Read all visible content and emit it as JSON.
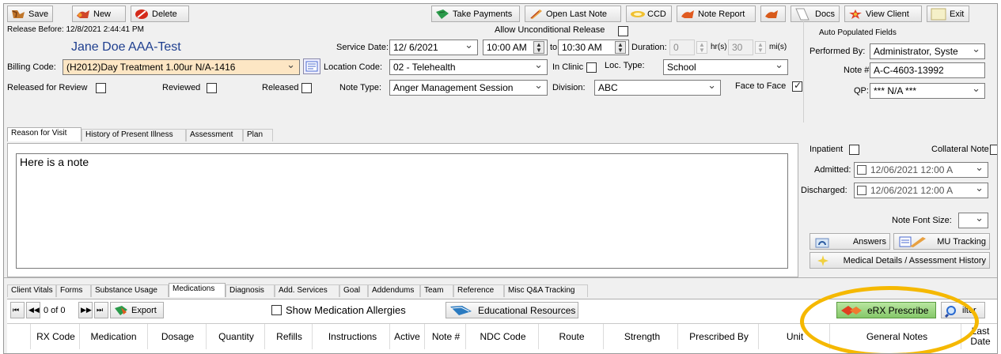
{
  "toolbar": {
    "save": "Save",
    "new": "New",
    "delete": "Delete",
    "take_payments": "Take Payments",
    "open_last_note": "Open Last Note",
    "ccd": "CCD",
    "note_report": "Note Report",
    "docs": "Docs",
    "view_client": "View Client",
    "exit": "Exit"
  },
  "header": {
    "release_before": "Release Before: 12/8/2021 2:44:41 PM",
    "client_name": "Jane Doe AAA-Test",
    "allow_unconditional_release": "Allow Unconditional Release",
    "auto_populated_fields": "Auto Populated Fields"
  },
  "form": {
    "billing_code_label": "Billing Code:",
    "billing_code_value": "(H2012)Day Treatment   1.00ur  N/A-1416",
    "service_date_label": "Service Date:",
    "service_date_value": "12/ 6/2021",
    "time_from": "10:00 AM",
    "to_label": "to",
    "time_to": "10:30 AM",
    "duration_label": "Duration:",
    "duration_hours": "0",
    "hrs_label": "hr(s)",
    "duration_minutes": "30",
    "mins_label": "mi(s)",
    "location_code_label": "Location Code:",
    "location_code_value": "02 - Telehealth",
    "in_clinic_label": "In Clinic",
    "loc_type_label": "Loc. Type:",
    "loc_type_value": "School",
    "released_for_review": "Released for Review",
    "reviewed": "Reviewed",
    "released": "Released",
    "note_type_label": "Note Type:",
    "note_type_value": "Anger Management Session",
    "division_label": "Division:",
    "division_value": "ABC",
    "face_to_face": "Face to Face",
    "performed_by_label": "Performed By:",
    "performed_by_value": "Administrator, Syste",
    "note_num_label": "Note #:",
    "note_num_value": "A-C-4603-13992",
    "qp_label": "QP:",
    "qp_value": "*** N/A ***"
  },
  "note_tabs": [
    "Reason for Visit",
    "History of Present Illness",
    "Assessment",
    "Plan"
  ],
  "note_text": "Here is a note",
  "right_panel": {
    "inpatient": "Inpatient",
    "collateral_note": "Collateral Note",
    "admitted_label": "Admitted:",
    "admitted_value": "12/06/2021 12:00 A",
    "discharged_label": "Discharged:",
    "discharged_value": "12/06/2021 12:00 A",
    "note_font_size": "Note Font Size:",
    "answers": "Answers",
    "mu_tracking": "MU Tracking",
    "medical_details": "Medical Details / Assessment History"
  },
  "bottom_tabs": [
    "Client Vitals",
    "Forms",
    "Substance Usage",
    "Medications",
    "Diagnosis",
    "Add. Services",
    "Goal",
    "Addendums",
    "Team",
    "Reference",
    "Misc Q&A Tracking"
  ],
  "med_toolbar": {
    "record_count": "0 of 0",
    "export": "Export",
    "show_med_allergies": "Show Medication Allergies",
    "educational_resources": "Educational Resources",
    "erx_prescribe": "eRX Prescribe",
    "filter": "ilter"
  },
  "med_columns": [
    "RX Code",
    "Medication",
    "Dosage",
    "Quantity",
    "Refills",
    "Instructions",
    "Active",
    "Note #",
    "NDC Code",
    "Route",
    "Strength",
    "Prescribed By",
    "Unit",
    "General Notes",
    "Last Date"
  ],
  "colors": {
    "highlight_ring": "#f5b800",
    "label_blue": "#1f3f8f"
  }
}
